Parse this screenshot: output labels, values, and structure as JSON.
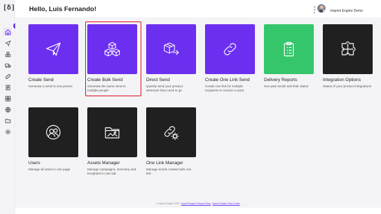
{
  "brand": {
    "logo_text": "[δ]",
    "accent": "#6c2ff0",
    "green": "#35c66c",
    "dark": "#202020",
    "selection": "#e00d1e"
  },
  "header": {
    "greeting": "Hello, Luis Fernando!",
    "user_name": "Imprint Engine Demo"
  },
  "sidebar": {
    "items": [
      {
        "icon": "home-icon",
        "active": true
      },
      {
        "icon": "send-icon",
        "active": false
      },
      {
        "icon": "boxes-icon",
        "active": false
      },
      {
        "icon": "truck-icon",
        "active": false
      },
      {
        "icon": "link-icon",
        "active": false
      },
      {
        "icon": "report-icon",
        "active": false
      },
      {
        "icon": "grid-icon",
        "active": false
      },
      {
        "icon": "globe-icon",
        "active": false
      },
      {
        "icon": "folder-icon",
        "active": false
      },
      {
        "icon": "settings-icon",
        "active": false
      }
    ]
  },
  "cards": [
    {
      "title": "Create Send",
      "desc": "Generate a send to one person",
      "color": "purple",
      "icon": "paper-plane-icon"
    },
    {
      "title": "Create Bulk Send",
      "desc": "Generate the same send to multiple people",
      "color": "purple",
      "icon": "boxes-icon",
      "selected": true
    },
    {
      "title": "Direct Send",
      "desc": "Quickly send your product wherever they need to go",
      "color": "purple",
      "icon": "box-arrow-icon"
    },
    {
      "title": "Create One Link Send",
      "desc": "Create one link for multiple recipients to receive a send",
      "color": "purple",
      "icon": "link-icon"
    },
    {
      "title": "Delivery Reports",
      "desc": "See past sends and their status",
      "color": "green",
      "icon": "clipboard-icon"
    },
    {
      "title": "Integration Options",
      "desc": "Status of your product integrations",
      "color": "black",
      "icon": "puzzle-icon"
    },
    {
      "title": "Users",
      "desc": "Manage all users in one page",
      "color": "black",
      "icon": "users-icon"
    },
    {
      "title": "Assets Manager",
      "desc": "Manage campaigns, inventory and templates in one tab",
      "color": "black",
      "icon": "folder-image-icon"
    },
    {
      "title": "One Link Manager",
      "desc": "Manage sends created with one link",
      "color": "black",
      "icon": "link-gear-icon"
    }
  ],
  "footer": {
    "copyright": "© Imprint Engine 2025 ·",
    "privacy_link": "Imprint Engine Privacy Policy",
    "separator": "|",
    "terms_link": "Imprint Engine Help Center"
  }
}
